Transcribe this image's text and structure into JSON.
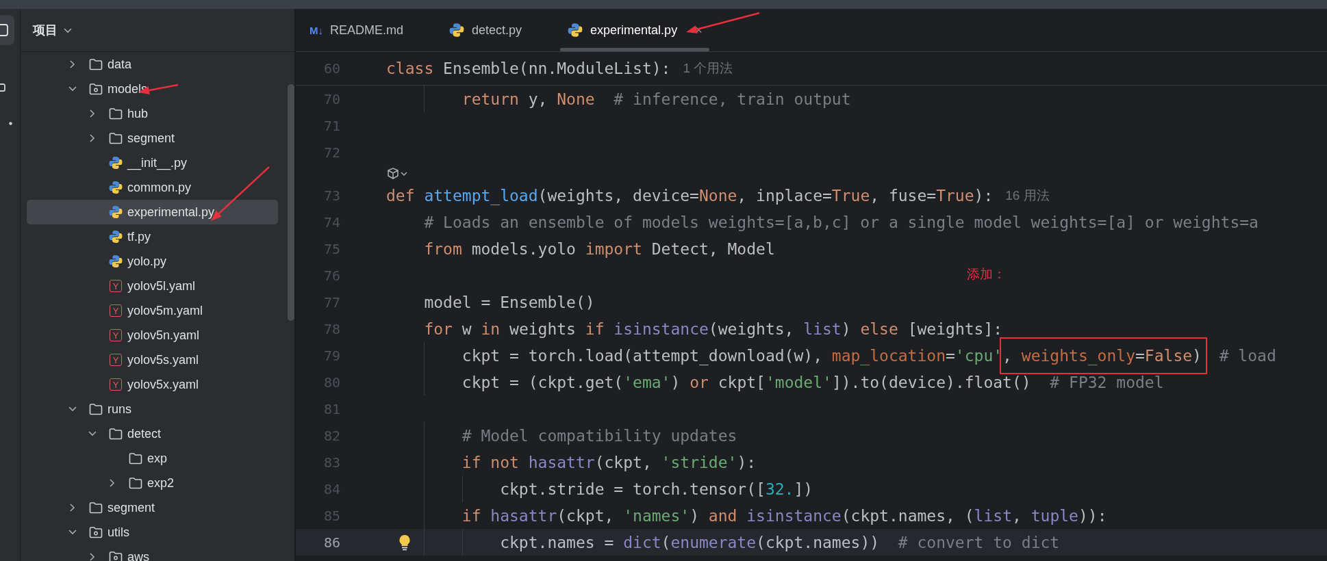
{
  "project_panel": {
    "title": "项目"
  },
  "tree": [
    {
      "name": "data",
      "kind": "folder",
      "expanded": false,
      "selected": false
    },
    {
      "name": "models",
      "kind": "module",
      "expanded": true,
      "selected": false,
      "children": [
        {
          "name": "hub",
          "kind": "folder",
          "expanded": false,
          "selected": false
        },
        {
          "name": "segment",
          "kind": "folder",
          "expanded": false,
          "selected": false
        },
        {
          "name": "__init__.py",
          "kind": "python",
          "selected": false
        },
        {
          "name": "common.py",
          "kind": "python",
          "selected": false
        },
        {
          "name": "experimental.py",
          "kind": "python",
          "selected": true
        },
        {
          "name": "tf.py",
          "kind": "python",
          "selected": false
        },
        {
          "name": "yolo.py",
          "kind": "python",
          "selected": false
        },
        {
          "name": "yolov5l.yaml",
          "kind": "yaml",
          "icon_text": "Y",
          "selected": false
        },
        {
          "name": "yolov5m.yaml",
          "kind": "yaml",
          "icon_text": "Y",
          "selected": false
        },
        {
          "name": "yolov5n.yaml",
          "kind": "yaml",
          "icon_text": "Y",
          "selected": false
        },
        {
          "name": "yolov5s.yaml",
          "kind": "yaml",
          "icon_text": "Y",
          "selected": false
        },
        {
          "name": "yolov5x.yaml",
          "kind": "yaml",
          "icon_text": "Y",
          "selected": false
        }
      ]
    },
    {
      "name": "runs",
      "kind": "folder",
      "expanded": true,
      "selected": false,
      "children": [
        {
          "name": "detect",
          "kind": "folder",
          "expanded": true,
          "selected": false,
          "children": [
            {
              "name": "exp",
              "kind": "folder",
              "selected": false
            },
            {
              "name": "exp2",
              "kind": "folder",
              "expanded": false,
              "selected": false
            }
          ]
        }
      ]
    },
    {
      "name": "segment",
      "kind": "folder",
      "expanded": false,
      "selected": false
    },
    {
      "name": "utils",
      "kind": "module",
      "expanded": true,
      "selected": false,
      "children": [
        {
          "name": "aws",
          "kind": "module",
          "expanded": false,
          "selected": false
        }
      ]
    }
  ],
  "tabs": [
    {
      "label": "README.md",
      "kind": "markdown",
      "icon_text": "M↓",
      "selected": false
    },
    {
      "label": "detect.py",
      "kind": "python",
      "selected": false
    },
    {
      "label": "experimental.py",
      "kind": "python",
      "selected": true,
      "close": "×"
    }
  ],
  "sticky_line": {
    "number": "60",
    "tokens": [
      {
        "kind": "kw",
        "text": "class"
      },
      {
        "kind": "plain",
        "text": " Ensemble(nn.ModuleList):"
      }
    ],
    "hint": "1 个用法"
  },
  "lines": [
    {
      "kind": "code",
      "number": "70",
      "current": false,
      "tokens": [
        {
          "kind": "kw",
          "text": "        return"
        },
        {
          "kind": "plain",
          "text": " y, "
        },
        {
          "kind": "kw",
          "text": "None"
        },
        {
          "kind": "comment",
          "text": "  # inference, train output"
        }
      ]
    },
    {
      "kind": "code",
      "number": "71",
      "current": false
    },
    {
      "kind": "code",
      "number": "72",
      "current": false
    },
    {
      "kind": "inlay"
    },
    {
      "kind": "code",
      "number": "73",
      "current": false,
      "tokens": [
        {
          "kind": "kw",
          "text": "def "
        },
        {
          "kind": "fn",
          "text": "attempt_load"
        },
        {
          "kind": "plain",
          "text": "(weights, device="
        },
        {
          "kind": "kw",
          "text": "None"
        },
        {
          "kind": "plain",
          "text": ", inplace="
        },
        {
          "kind": "kw",
          "text": "True"
        },
        {
          "kind": "plain",
          "text": ", fuse="
        },
        {
          "kind": "kw",
          "text": "True"
        },
        {
          "kind": "plain",
          "text": "):"
        }
      ],
      "hint": "16 用法"
    },
    {
      "kind": "code",
      "number": "74",
      "current": false,
      "tokens": [
        {
          "kind": "comment",
          "text": "    # Loads an ensemble of models weights=[a,b,c] or a single model weights=[a] or weights=a"
        }
      ]
    },
    {
      "kind": "code",
      "number": "75",
      "current": false,
      "tokens": [
        {
          "kind": "kw",
          "text": "    from"
        },
        {
          "kind": "plain",
          "text": " models.yolo "
        },
        {
          "kind": "kw",
          "text": "import"
        },
        {
          "kind": "plain",
          "text": " Detect, Model"
        }
      ]
    },
    {
      "kind": "code",
      "number": "76",
      "current": false
    },
    {
      "kind": "code",
      "number": "77",
      "current": false,
      "tokens": [
        {
          "kind": "plain",
          "text": "    model = Ensemble()"
        }
      ]
    },
    {
      "kind": "code",
      "number": "78",
      "current": false,
      "tokens": [
        {
          "kind": "kw",
          "text": "    for"
        },
        {
          "kind": "plain",
          "text": " w "
        },
        {
          "kind": "kw",
          "text": "in"
        },
        {
          "kind": "plain",
          "text": " weights "
        },
        {
          "kind": "kw",
          "text": "if"
        },
        {
          "kind": "builtin",
          "text": " isinstance"
        },
        {
          "kind": "plain",
          "text": "(weights, "
        },
        {
          "kind": "builtin",
          "text": "list"
        },
        {
          "kind": "plain",
          "text": ") "
        },
        {
          "kind": "kw",
          "text": "else"
        },
        {
          "kind": "plain",
          "text": " [weights]:"
        }
      ]
    },
    {
      "kind": "code",
      "number": "79",
      "current": false,
      "tokens": [
        {
          "kind": "plain",
          "text": "        ckpt = torch.load(attempt_download(w), "
        },
        {
          "kind": "param",
          "text": "map_location"
        },
        {
          "kind": "plain",
          "text": "="
        },
        {
          "kind": "str",
          "text": "'cpu'"
        },
        {
          "kind": "box",
          "parts": [
            {
              "kind": "plain",
              "text": ", "
            },
            {
              "kind": "param",
              "text": "weights_only"
            },
            {
              "kind": "plain",
              "text": "="
            },
            {
              "kind": "kw",
              "text": "False"
            },
            {
              "kind": "plain",
              "text": ")"
            }
          ]
        },
        {
          "kind": "comment",
          "text": "  # load"
        }
      ]
    },
    {
      "kind": "code",
      "number": "80",
      "current": false,
      "tokens": [
        {
          "kind": "plain",
          "text": "        ckpt = (ckpt.get("
        },
        {
          "kind": "str",
          "text": "'ema'"
        },
        {
          "kind": "plain",
          "text": ") "
        },
        {
          "kind": "kw",
          "text": "or"
        },
        {
          "kind": "plain",
          "text": " ckpt["
        },
        {
          "kind": "str",
          "text": "'model'"
        },
        {
          "kind": "plain",
          "text": "]).to(device).float()"
        },
        {
          "kind": "comment",
          "text": "  # FP32 model"
        }
      ]
    },
    {
      "kind": "code",
      "number": "81",
      "current": false
    },
    {
      "kind": "code",
      "number": "82",
      "current": false,
      "tokens": [
        {
          "kind": "comment",
          "text": "        # Model compatibility updates"
        }
      ]
    },
    {
      "kind": "code",
      "number": "83",
      "current": false,
      "tokens": [
        {
          "kind": "kw",
          "text": "        if not"
        },
        {
          "kind": "builtin",
          "text": " hasattr"
        },
        {
          "kind": "plain",
          "text": "(ckpt, "
        },
        {
          "kind": "str",
          "text": "'stride'"
        },
        {
          "kind": "plain",
          "text": "):"
        }
      ]
    },
    {
      "kind": "code",
      "number": "84",
      "current": false,
      "tokens": [
        {
          "kind": "plain",
          "text": "            ckpt.stride = torch.tensor(["
        },
        {
          "kind": "num",
          "text": "32."
        },
        {
          "kind": "plain",
          "text": "])"
        }
      ]
    },
    {
      "kind": "code",
      "number": "85",
      "current": false,
      "tokens": [
        {
          "kind": "kw",
          "text": "        if"
        },
        {
          "kind": "builtin",
          "text": " hasattr"
        },
        {
          "kind": "plain",
          "text": "(ckpt, "
        },
        {
          "kind": "str",
          "text": "'names'"
        },
        {
          "kind": "plain",
          "text": ") "
        },
        {
          "kind": "kw",
          "text": "and"
        },
        {
          "kind": "builtin",
          "text": " isinstance"
        },
        {
          "kind": "plain",
          "text": "(ckpt.names, ("
        },
        {
          "kind": "builtin",
          "text": "list"
        },
        {
          "kind": "plain",
          "text": ", "
        },
        {
          "kind": "builtin",
          "text": "tuple"
        },
        {
          "kind": "plain",
          "text": ")):"
        }
      ]
    },
    {
      "kind": "code",
      "number": "86",
      "current": true,
      "bulb": true,
      "tokens": [
        {
          "kind": "plain",
          "text": "            ckpt.names = "
        },
        {
          "kind": "builtin",
          "text": "dict"
        },
        {
          "kind": "plain",
          "text": "("
        },
        {
          "kind": "builtin",
          "text": "enumerate"
        },
        {
          "kind": "plain",
          "text": "(ckpt.names))"
        },
        {
          "kind": "comment",
          "text": "  # convert to dict"
        }
      ]
    }
  ],
  "annotation": {
    "label": "添加："
  }
}
